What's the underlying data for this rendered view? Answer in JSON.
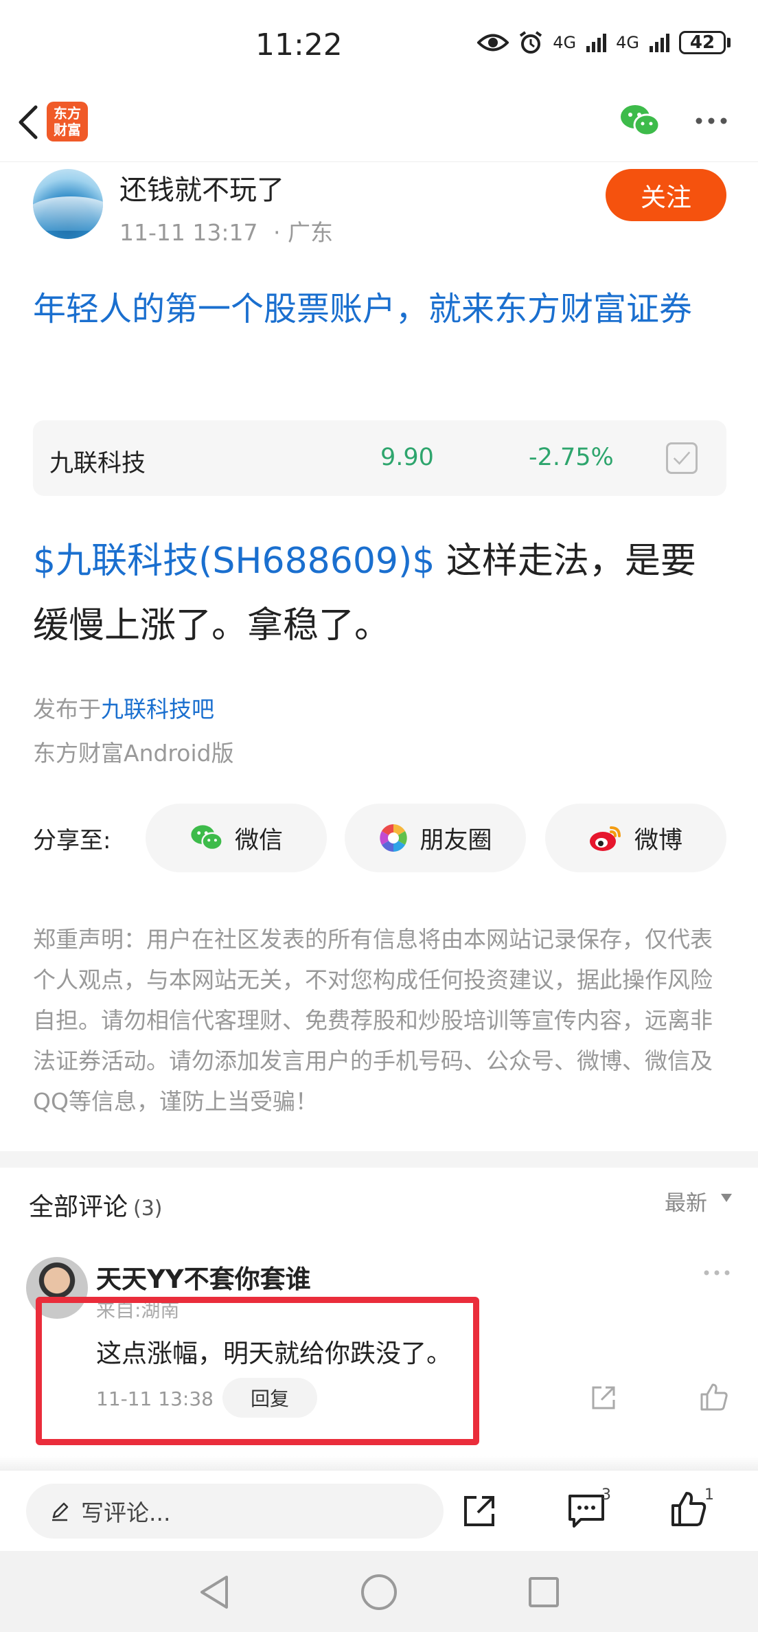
{
  "status_bar": {
    "time": "11:22",
    "signal_1": "4G",
    "signal_2": "4G",
    "battery": "42"
  },
  "header": {
    "logo_line1": "东方",
    "logo_line2": "财富"
  },
  "author": {
    "name": "还钱就不玩了",
    "time": "11-11 13:17",
    "location": "· 广东",
    "follow_label": "关注"
  },
  "post": {
    "title": "年轻人的第一个股票账户，就来东方财富证券",
    "stock_card": {
      "name": "九联科技",
      "price": "9.90",
      "change": "-2.75%"
    },
    "content_link": "$九联科技(SH688609)$",
    "content_text": " 这样走法，是要缓慢上涨了。拿稳了。",
    "published_prefix": "发布于",
    "forum": "九联科技吧",
    "client": "东方财富Android版"
  },
  "share": {
    "label": "分享至:",
    "wechat": "微信",
    "moments": "朋友圈",
    "weibo": "微博"
  },
  "disclaimer": "郑重声明：用户在社区发表的所有信息将由本网站记录保存，仅代表个人观点，与本网站无关，不对您构成任何投资建议，据此操作风险自担。请勿相信代客理财、免费荐股和炒股培训等宣传内容，远离非法证券活动。请勿添加发言用户的手机号码、公众号、微博、微信及QQ等信息，谨防上当受骗！",
  "comments": {
    "title": "全部评论",
    "count": "(3)",
    "sort": "最新",
    "first": {
      "user": "天天YY不套你套谁",
      "location": "来自:湖南",
      "text": "这点涨幅，明天就给你跌没了。",
      "time": "11-11 13:38",
      "reply_label": "回复"
    }
  },
  "bottom_bar": {
    "placeholder": "写评论...",
    "comment_count": "3",
    "like_count": "1"
  },
  "colors": {
    "brand_orange": "#f5520e",
    "link_blue": "#1a6fcf",
    "down_green": "#2ea56d",
    "highlight_red": "#ea2d3b"
  }
}
